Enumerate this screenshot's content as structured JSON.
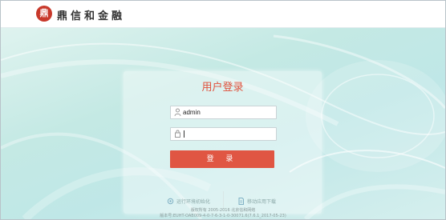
{
  "header": {
    "logo_seal": "鼎",
    "logo_text": "鼎信和金融"
  },
  "login": {
    "title": "用户登录",
    "username_value": "admin",
    "password_value": "",
    "submit_label": "登 录"
  },
  "links": [
    {
      "label": "运行环境初始化",
      "icon": "gear-icon"
    },
    {
      "label": "移动应用下载",
      "icon": "document-icon"
    }
  ],
  "footer": {
    "copyright": "版权所有 2005-2016 北京信和网络",
    "version": "版本号:EUHT-OAB009-4-0-7-6-3-1-0-30071.6(7.6.1_2017-05-23)"
  },
  "colors": {
    "accent": "#e05643",
    "title": "#e0513c",
    "background": "#c4e9e4"
  }
}
